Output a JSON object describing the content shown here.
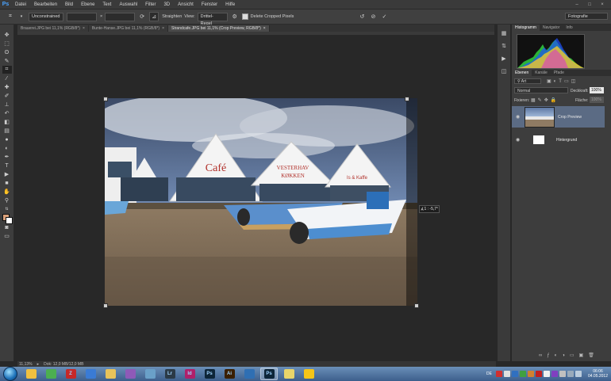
{
  "app": {
    "logo": "Ps"
  },
  "menu": [
    "Datei",
    "Bearbeiten",
    "Bild",
    "Ebene",
    "Text",
    "Auswahl",
    "Filter",
    "3D",
    "Ansicht",
    "Fenster",
    "Hilfe"
  ],
  "window_controls": {
    "minimize": "–",
    "maximize": "□",
    "close": "×"
  },
  "options": {
    "ratio": "Unconstrained",
    "swap": "×",
    "straighten": "Straighten",
    "view_label": "View:",
    "view_value": "Drittel-Regel",
    "delete_cropped": "Delete Cropped Pixels",
    "workspace": "Fotografie"
  },
  "tabs": [
    {
      "label": "Brauerei.JPG bei 11,1% (RGB/8*)",
      "close": "×"
    },
    {
      "label": "Bunte-Hanse.JPG bei 11,1% (RGB/8*)",
      "close": "×"
    },
    {
      "label": "Strandcafe.JPG bei 11,1% (Crop Preview, RGB/8*)",
      "close": "×"
    }
  ],
  "canvas": {
    "angle_tooltip": "∡1 : -5,7°"
  },
  "status": {
    "zoom": "11,13%",
    "doc": "Dok: 12,0 MB/12,0 MB"
  },
  "panels": {
    "histogram_tabs": [
      "Histogramm",
      "Navigator",
      "Info"
    ],
    "histogram_warning": "⚠",
    "layers_tabs": [
      "Ebenen",
      "Kanäle",
      "Pfade"
    ],
    "kind": "Art",
    "blend_mode": "Normal",
    "opacity_label": "Deckkraft:",
    "opacity": "100%",
    "lock_label": "Fixieren:",
    "fill_label": "Fläche:",
    "fill": "100%",
    "layers": [
      {
        "name": "Crop Preview",
        "active": true
      },
      {
        "name": "Hintergrund",
        "active": false
      }
    ],
    "footer_icons": [
      "link-icon",
      "fx-icon",
      "mask-icon",
      "adjustment-icon",
      "group-icon",
      "new-layer-icon",
      "trash-icon"
    ]
  },
  "taskbar": {
    "apps": [
      {
        "name": "explorer",
        "glyph": "",
        "color": "#f0c040"
      },
      {
        "name": "chrome",
        "glyph": "",
        "color": "#4caf50"
      },
      {
        "name": "filezilla",
        "glyph": "Z",
        "color": "#c62828"
      },
      {
        "name": "thunderbird",
        "glyph": "",
        "color": "#3a7bd5"
      },
      {
        "name": "folder",
        "glyph": "",
        "color": "#e8c35a"
      },
      {
        "name": "app-purple",
        "glyph": "",
        "color": "#8e5ab8"
      },
      {
        "name": "app-tools",
        "glyph": "",
        "color": "#6aa0c8"
      },
      {
        "name": "lightroom",
        "glyph": "Lr",
        "color": "#2b3a47"
      },
      {
        "name": "indesign",
        "glyph": "Id",
        "color": "#b0206a"
      },
      {
        "name": "photoshop",
        "glyph": "Ps",
        "color": "#0d2538"
      },
      {
        "name": "illustrator",
        "glyph": "Ai",
        "color": "#3a1f00"
      },
      {
        "name": "app-blue",
        "glyph": "",
        "color": "#2f6fb3"
      },
      {
        "name": "photoshop-active",
        "glyph": "Ps",
        "color": "#0d2538"
      },
      {
        "name": "folder2",
        "glyph": "",
        "color": "#e8d56a"
      },
      {
        "name": "messenger",
        "glyph": "",
        "color": "#f5c518"
      }
    ],
    "lang": "DE",
    "time": "06:06",
    "date": "04.05.2012"
  },
  "colors": {
    "accent": "#4aa3ff",
    "selected_layer": "#5b6b84"
  }
}
